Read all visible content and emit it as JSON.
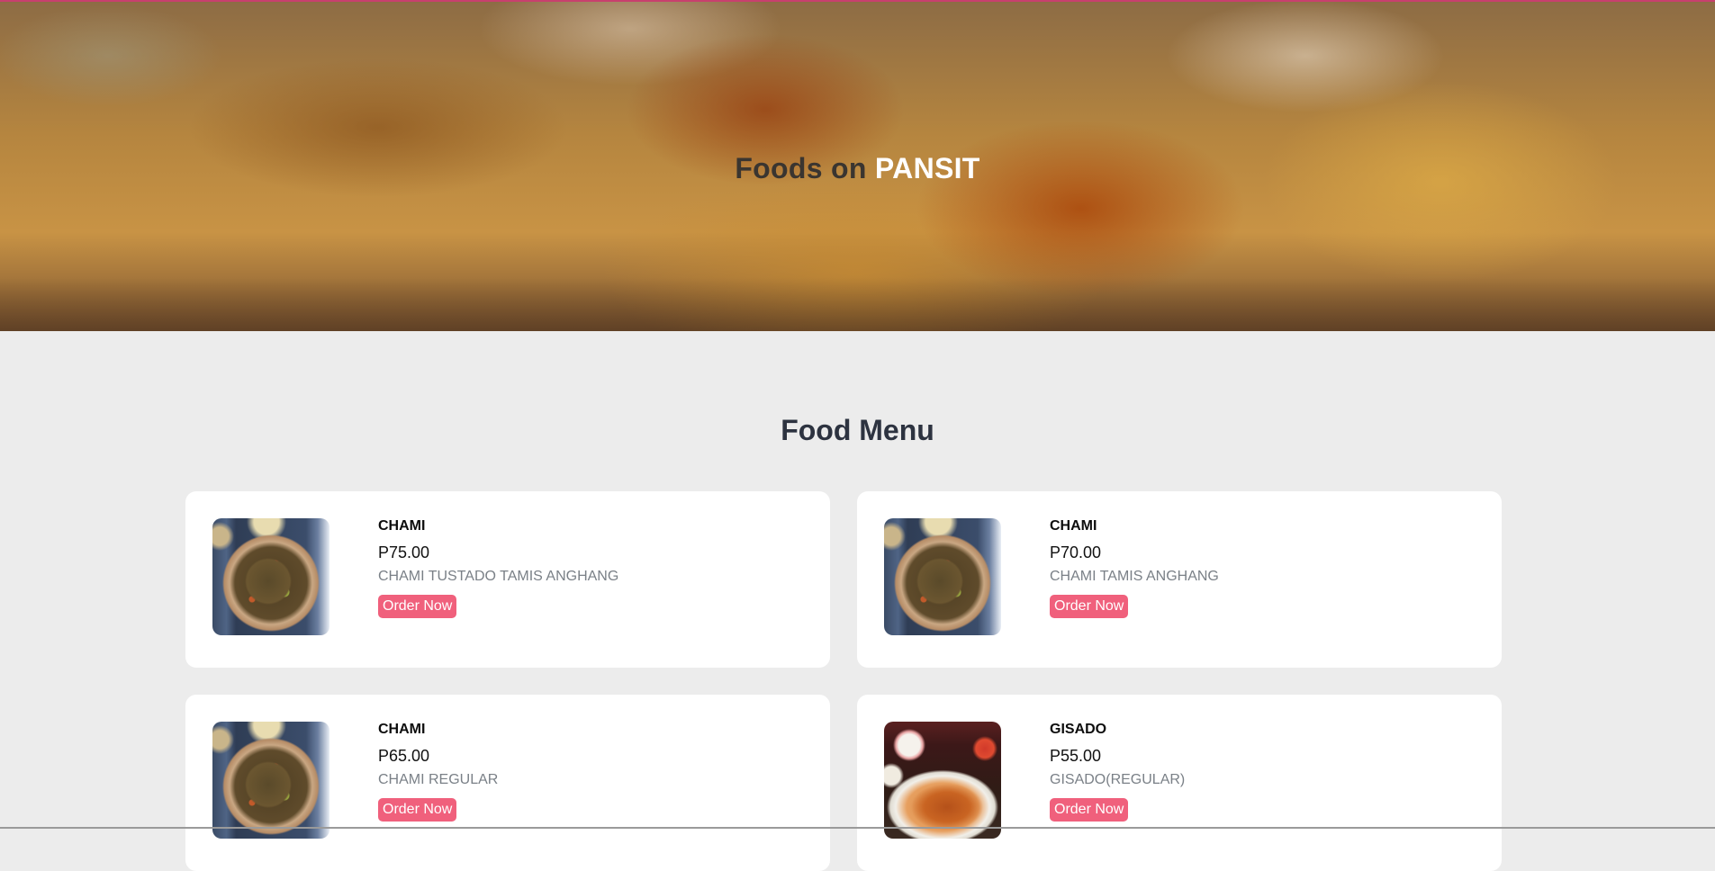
{
  "hero": {
    "title_prefix": "Foods on",
    "title_highlight": "PANSIT"
  },
  "menu": {
    "title": "Food Menu",
    "items": [
      {
        "name": "CHAMI",
        "price": "P75.00",
        "description": "CHAMI TUSTADO TAMIS ANGHANG",
        "button_label": "Order Now",
        "image": "chami-noodle-bowl-photo"
      },
      {
        "name": "CHAMI",
        "price": "P70.00",
        "description": "CHAMI TAMIS ANGHANG",
        "button_label": "Order Now",
        "image": "chami-noodle-bowl-photo"
      },
      {
        "name": "CHAMI",
        "price": "P65.00",
        "description": "CHAMI REGULAR",
        "button_label": "Order Now",
        "image": "chami-noodle-bowl-photo"
      },
      {
        "name": "GISADO",
        "price": "P55.00",
        "description": "GISADO(REGULAR)",
        "button_label": "Order Now",
        "image": "gisado-noodle-plate-photo"
      }
    ]
  },
  "colors": {
    "accent": "#f0607c",
    "heading": "#2d3340",
    "page_background": "#ececec",
    "card_background": "#ffffff",
    "description_text": "#7a8087"
  }
}
